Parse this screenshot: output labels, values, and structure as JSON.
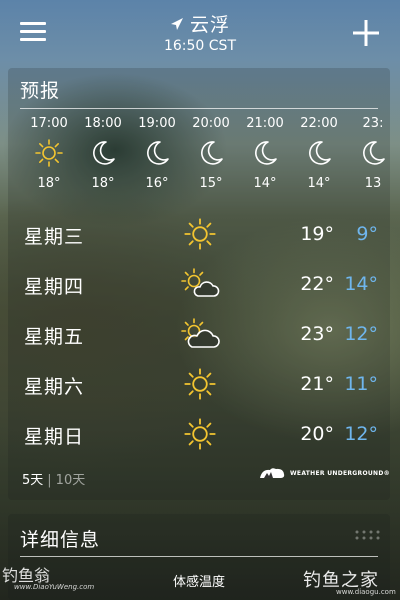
{
  "header": {
    "city": "云浮",
    "time": "16:50 CST",
    "menu_icon": "hamburger-menu-icon",
    "add_icon": "plus-icon",
    "location_icon": "location-arrow-icon"
  },
  "forecast": {
    "title": "预报",
    "hourly": [
      {
        "time": "17:00",
        "icon": "sun-icon",
        "temp": "18°"
      },
      {
        "time": "18:00",
        "icon": "moon-icon",
        "temp": "18°"
      },
      {
        "time": "19:00",
        "icon": "moon-icon",
        "temp": "16°"
      },
      {
        "time": "20:00",
        "icon": "moon-icon",
        "temp": "15°"
      },
      {
        "time": "21:00",
        "icon": "moon-icon",
        "temp": "14°"
      },
      {
        "time": "22:00",
        "icon": "moon-icon",
        "temp": "14°"
      },
      {
        "time": "23:",
        "icon": "moon-icon",
        "temp": "13"
      }
    ],
    "daily": [
      {
        "day": "星期三",
        "icon": "sun-icon",
        "high": "19°",
        "low": "9°"
      },
      {
        "day": "星期四",
        "icon": "partly-cloudy-icon",
        "high": "22°",
        "low": "14°"
      },
      {
        "day": "星期五",
        "icon": "partly-cloudy-icon",
        "high": "23°",
        "low": "12°"
      },
      {
        "day": "星期六",
        "icon": "sun-icon",
        "high": "21°",
        "low": "11°"
      },
      {
        "day": "星期日",
        "icon": "sun-icon",
        "high": "20°",
        "low": "12°"
      }
    ],
    "tab_5": "5天",
    "tab_separator": "|",
    "tab_10": "10天",
    "provider": "WEATHER UNDERGROUND®"
  },
  "details": {
    "title": "详细信息",
    "feels_like": "体感温度"
  },
  "watermark": {
    "left": "钓鱼翁",
    "left_sub": "www.DiaoYuWeng.com",
    "right": "钓鱼之家",
    "right_sub": "www.diaogu.com"
  },
  "colors": {
    "low_temp": "#6fb6ee",
    "sun": "#f3c530"
  }
}
